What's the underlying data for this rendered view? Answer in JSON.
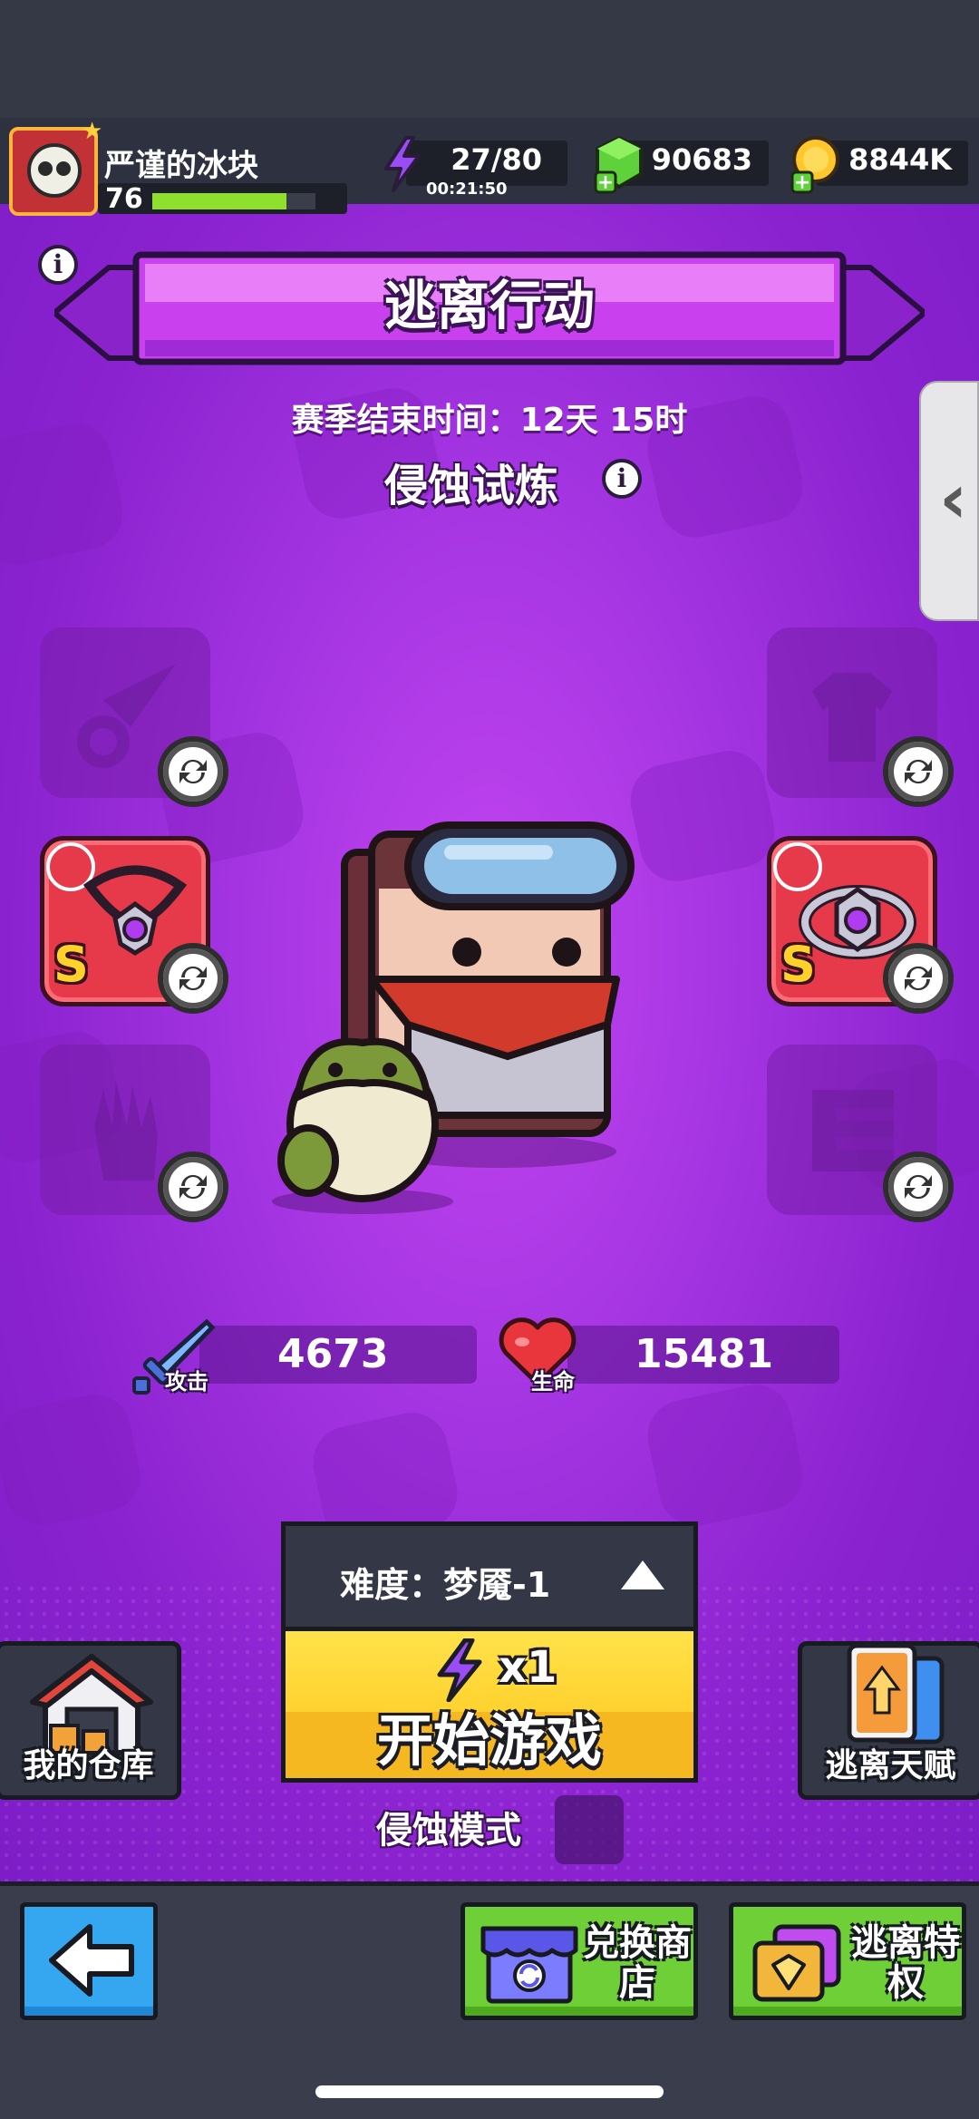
{
  "player": {
    "name": "严谨的冰块",
    "level": "76",
    "xp_fraction": 0.82
  },
  "resources": {
    "energy": "27/80",
    "energy_timer": "00:21:50",
    "gems": "90683",
    "coins": "8844K"
  },
  "banner": {
    "title": "逃离行动"
  },
  "season": {
    "text": "赛季结束时间：12天 15时"
  },
  "mode": {
    "title": "侵蚀试炼"
  },
  "equipment": {
    "left": [
      "weapon",
      "necklace",
      "gloves"
    ],
    "right": [
      "armor",
      "ring",
      "belt"
    ],
    "necklace_grade": "S",
    "ring_grade": "S"
  },
  "stats": {
    "attack_label": "攻击",
    "attack_value": "4673",
    "hp_label": "生命",
    "hp_value": "15481"
  },
  "difficulty": {
    "label": "难度：梦魇-1"
  },
  "start": {
    "cost": "x1",
    "label": "开始游戏"
  },
  "erosion_mode": {
    "label": "侵蚀模式"
  },
  "corners": {
    "warehouse": "我的仓库",
    "talent": "逃离天赋"
  },
  "nav": {
    "exchange_shop": "兑换商店",
    "escape_privilege": "逃离特权"
  },
  "colors": {
    "accent_purple": "#a535e2",
    "start_yellow": "#ffd22f",
    "nav_green": "#6fcf36",
    "back_blue": "#35a6f0"
  }
}
